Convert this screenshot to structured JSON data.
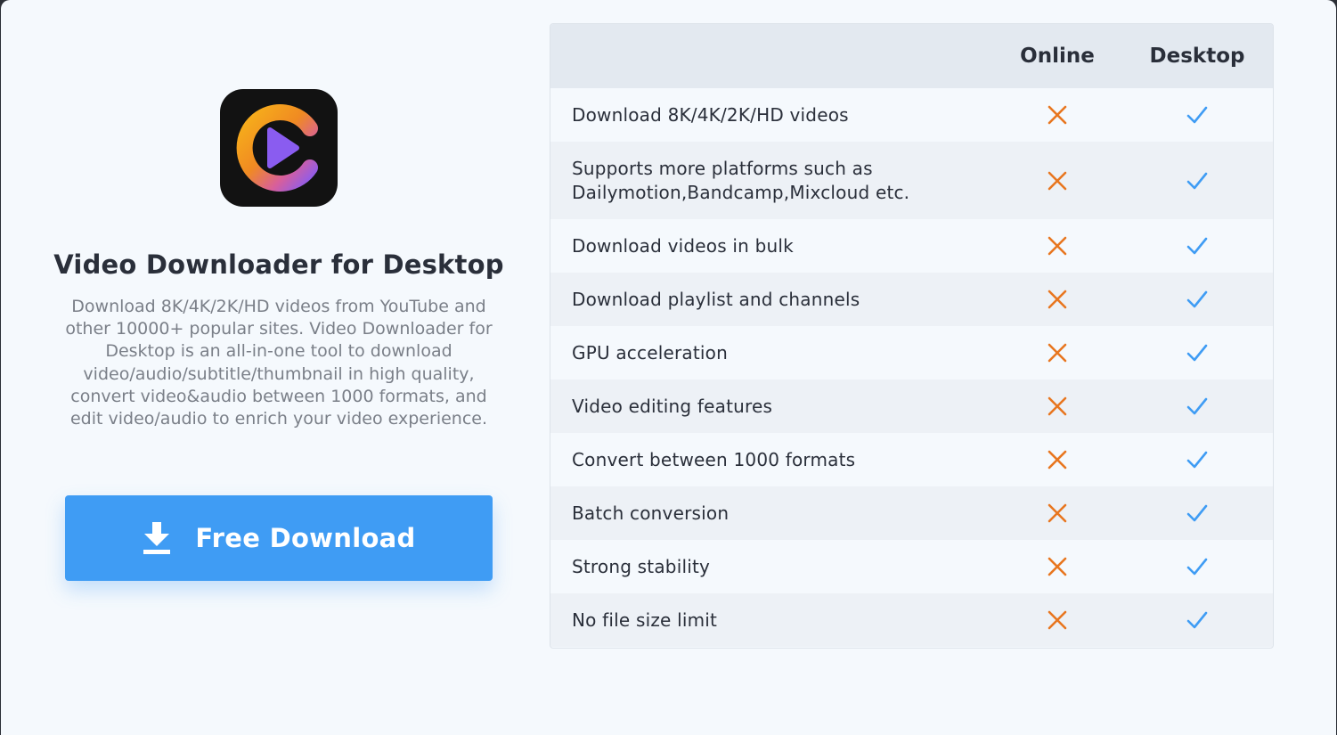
{
  "product": {
    "title": "Video Downloader for Desktop",
    "description": "Download 8K/4K/2K/HD videos from YouTube and other 10000+ popular sites. Video Downloader for Desktop is an all-in-one tool to download video/audio/subtitle/thumbnail in high quality, convert video&audio between 1000 formats, and edit video/audio to enrich your video experience.",
    "logo_icon": "play-c-logo-icon"
  },
  "download_button": {
    "label": "Free Download",
    "icon": "download-icon",
    "color": "#3f9cf4"
  },
  "comparison": {
    "headers": {
      "online": "Online",
      "desktop": "Desktop"
    },
    "rows": [
      {
        "feature": "Download 8K/4K/2K/HD videos",
        "online": false,
        "desktop": true
      },
      {
        "feature": "Supports more platforms such as Dailymotion,Bandcamp,Mixcloud etc.",
        "online": false,
        "desktop": true
      },
      {
        "feature": "Download videos in bulk",
        "online": false,
        "desktop": true
      },
      {
        "feature": "Download playlist and channels",
        "online": false,
        "desktop": true
      },
      {
        "feature": "GPU acceleration",
        "online": false,
        "desktop": true
      },
      {
        "feature": "Video editing features",
        "online": false,
        "desktop": true
      },
      {
        "feature": "Convert between 1000 formats",
        "online": false,
        "desktop": true
      },
      {
        "feature": "Batch conversion",
        "online": false,
        "desktop": true
      },
      {
        "feature": "Strong stability",
        "online": false,
        "desktop": true
      },
      {
        "feature": "No file size limit",
        "online": false,
        "desktop": true
      }
    ]
  },
  "colors": {
    "cross": "#e8761f",
    "check": "#3f9cf4"
  }
}
